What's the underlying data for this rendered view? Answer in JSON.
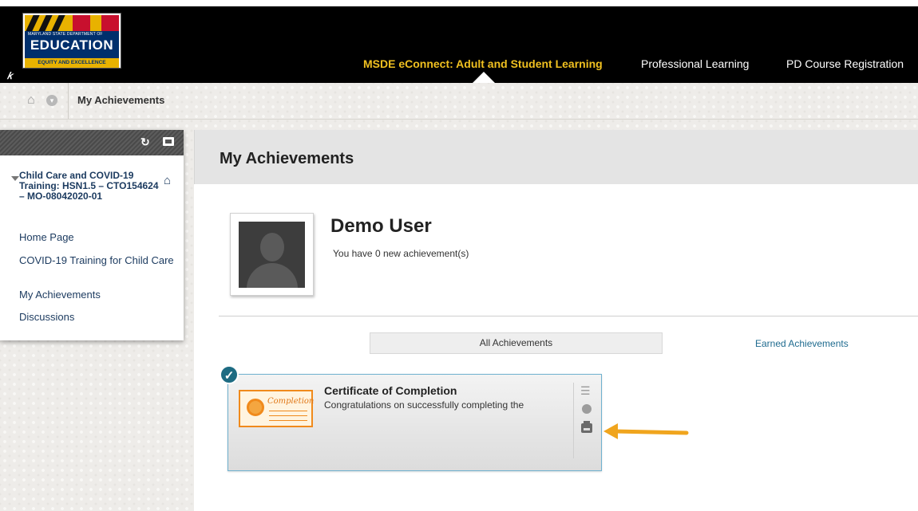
{
  "header": {
    "logo": {
      "dept": "MARYLAND STATE DEPARTMENT OF",
      "title": "EDUCATION",
      "tagline": "EQUITY AND EXCELLENCE"
    },
    "nav": [
      {
        "label": "MSDE eConnect: Adult and Student Learning",
        "active": true
      },
      {
        "label": "Professional Learning",
        "active": false
      },
      {
        "label": "PD Course Registration",
        "active": false
      }
    ],
    "accent_color": "#f0c020"
  },
  "breadcrumb": {
    "current": "My Achievements"
  },
  "sidebar": {
    "course_title": "Child Care and COVID-19 Training: HSN1.5 – CTO154624 – MO-08042020-01",
    "items": [
      {
        "label": "Home Page"
      },
      {
        "label": "COVID-19 Training for Child Care"
      },
      {
        "label": "My Achievements"
      },
      {
        "label": "Discussions"
      }
    ]
  },
  "main": {
    "title": "My Achievements",
    "user": {
      "name": "Demo User",
      "message": "You have 0 new achievement(s)"
    },
    "tabs": [
      {
        "label": "All Achievements",
        "selected": true
      },
      {
        "label": "Earned Achievements",
        "selected": false
      }
    ],
    "achievement": {
      "title": "Certificate of Completion",
      "description": "Congratulations on successfully completing the",
      "thumbnail_text": "Completion",
      "earned": true
    }
  },
  "colors": {
    "link": "#1f6b8f",
    "sidebar_link": "#1b3a5f",
    "badge": "#1d6b82",
    "arrow": "#f0a51e"
  }
}
